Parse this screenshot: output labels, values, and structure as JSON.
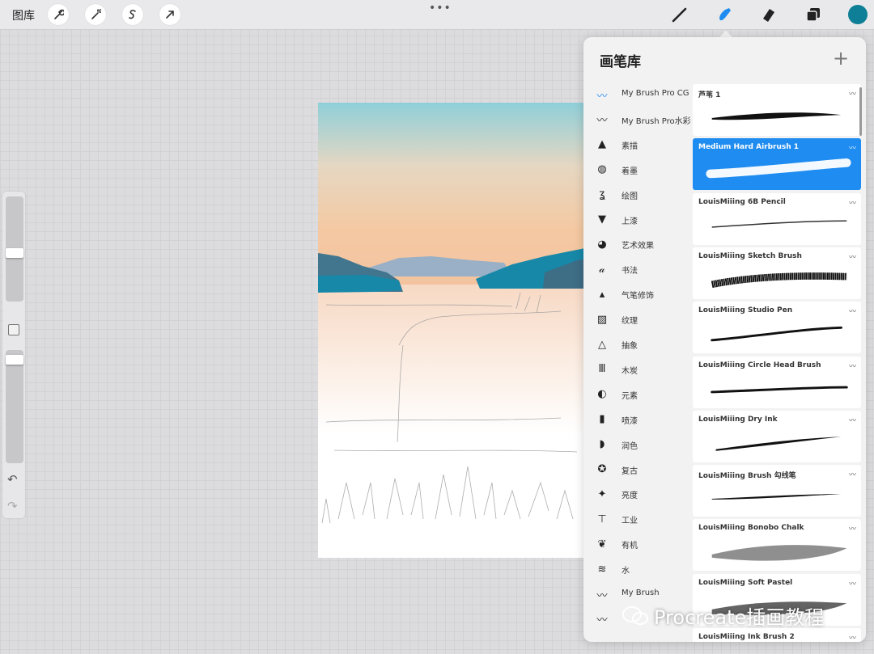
{
  "topbar": {
    "gallery_label": "图库",
    "more_dots": "•••",
    "color_hex": "#0e7f96"
  },
  "brush_panel": {
    "title": "画笔库",
    "add_label": "+",
    "categories": [
      {
        "label": "My Brush Pro CG",
        "icon": "brush-stroke-icon",
        "active": true
      },
      {
        "label": "My Brush Pro水彩",
        "icon": "brush-stroke-icon"
      },
      {
        "label": "素描",
        "icon": "pencil-tip-icon"
      },
      {
        "label": "着墨",
        "icon": "ink-drop-icon"
      },
      {
        "label": "绘图",
        "icon": "squiggle-icon"
      },
      {
        "label": "上漆",
        "icon": "paint-brush-icon"
      },
      {
        "label": "艺术效果",
        "icon": "palette-icon"
      },
      {
        "label": "书法",
        "icon": "calligraphy-icon"
      },
      {
        "label": "气笔修饰",
        "icon": "airbrush-icon"
      },
      {
        "label": "纹理",
        "icon": "texture-icon"
      },
      {
        "label": "抽象",
        "icon": "triangle-icon"
      },
      {
        "label": "木炭",
        "icon": "charcoal-icon"
      },
      {
        "label": "元素",
        "icon": "yin-yang-icon"
      },
      {
        "label": "喷漆",
        "icon": "spray-can-icon"
      },
      {
        "label": "润色",
        "icon": "smudge-icon"
      },
      {
        "label": "复古",
        "icon": "star-badge-icon"
      },
      {
        "label": "亮度",
        "icon": "sparkle-icon"
      },
      {
        "label": "工业",
        "icon": "anvil-icon"
      },
      {
        "label": "有机",
        "icon": "leaf-icon"
      },
      {
        "label": "水",
        "icon": "waves-icon"
      },
      {
        "label": "My Brush",
        "icon": "brush-stroke-icon"
      },
      {
        "label": "",
        "icon": "brush-stroke-icon"
      }
    ],
    "brushes": [
      {
        "name": "芦苇 1",
        "selected": false
      },
      {
        "name": "Medium Hard Airbrush 1",
        "selected": true
      },
      {
        "name": "LouisMiiing 6B Pencil",
        "selected": false
      },
      {
        "name": "LouisMiiing Sketch Brush",
        "selected": false
      },
      {
        "name": "LouisMiiing Studio Pen",
        "selected": false
      },
      {
        "name": "LouisMiiing Circle Head Brush",
        "selected": false
      },
      {
        "name": "LouisMiiing Dry Ink",
        "selected": false
      },
      {
        "name": "LouisMiiing Brush 勾线笔",
        "selected": false
      },
      {
        "name": "LouisMiiing Bonobo Chalk",
        "selected": false
      },
      {
        "name": "LouisMiiing Soft Pastel",
        "selected": false
      },
      {
        "name": "LouisMiiing Ink Brush 2",
        "selected": false
      }
    ]
  },
  "watermark": {
    "text": "Procreate插画教程"
  }
}
